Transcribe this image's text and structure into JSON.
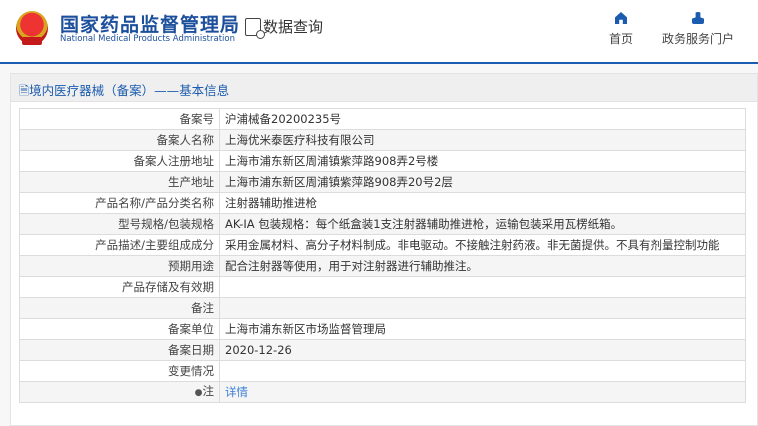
{
  "header": {
    "logo_cn": "国家药品监督管理局",
    "logo_en": "National Medical Products Administration",
    "data_query": "数据查询",
    "nav": [
      {
        "label": "首页",
        "icon": "home-icon"
      },
      {
        "label": "政务服务门户",
        "icon": "user-icon"
      }
    ]
  },
  "panel": {
    "title": "境内医疗器械（备案）——基本信息"
  },
  "rows": [
    {
      "label": "备案号",
      "value": "沪浦械备20200235号"
    },
    {
      "label": "备案人名称",
      "value": "上海优米泰医疗科技有限公司"
    },
    {
      "label": "备案人注册地址",
      "value": "上海市浦东新区周浦镇紫萍路908弄2号楼"
    },
    {
      "label": "生产地址",
      "value": "上海市浦东新区周浦镇紫萍路908弄20号2层"
    },
    {
      "label": "产品名称/产品分类名称",
      "value": "注射器辅助推进枪"
    },
    {
      "label": "型号规格/包装规格",
      "value": "AK-ⅠA 包装规格：每个纸盒装1支注射器辅助推进枪，运输包装采用瓦楞纸箱。"
    },
    {
      "label": "产品描述/主要组成成分",
      "value": "采用金属材料、高分子材料制成。非电驱动。不接触注射药液。非无菌提供。不具有剂量控制功能"
    },
    {
      "label": "预期用途",
      "value": "配合注射器等使用，用于对注射器进行辅助推注。"
    },
    {
      "label": "产品存储及有效期",
      "value": ""
    },
    {
      "label": "备注",
      "value": ""
    },
    {
      "label": "备案单位",
      "value": "上海市浦东新区市场监督管理局"
    },
    {
      "label": "备案日期",
      "value": "2020-12-26"
    },
    {
      "label": "变更情况",
      "value": ""
    },
    {
      "label": "注",
      "value": "详情"
    }
  ]
}
